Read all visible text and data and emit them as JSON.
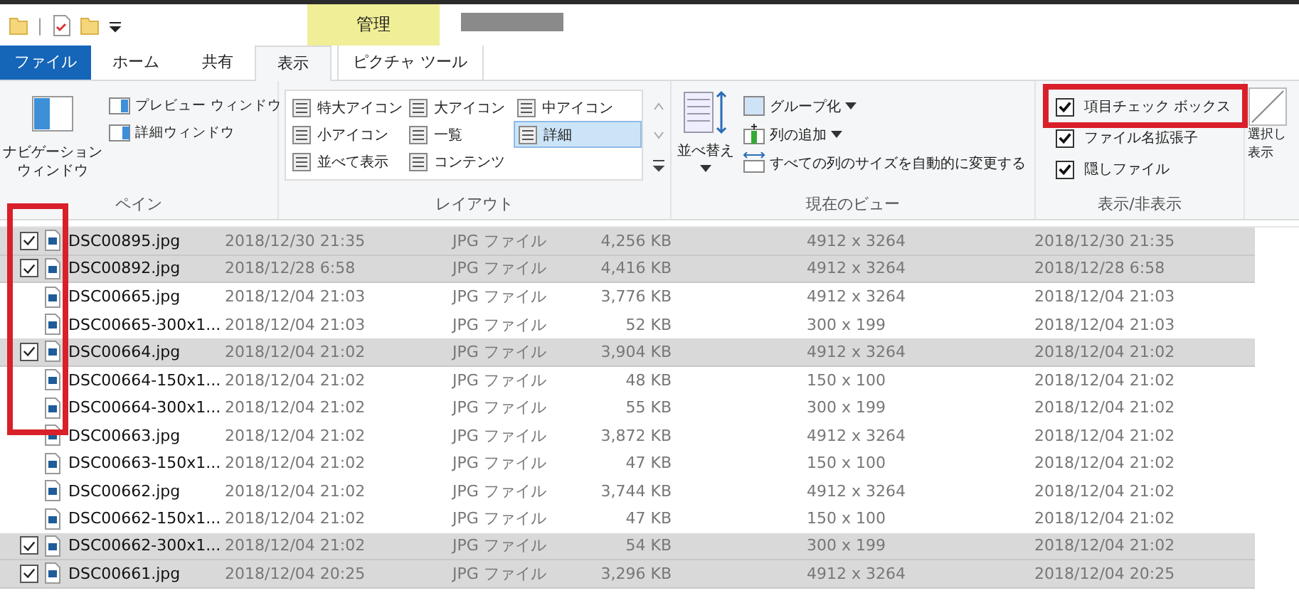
{
  "quick_access": {
    "separator": "|"
  },
  "context_tab": {
    "group": "管理",
    "label": "ピクチャ ツール"
  },
  "tabs": [
    {
      "label": "ファイル",
      "kind": "file",
      "selected": false
    },
    {
      "label": "ホーム",
      "kind": "plain",
      "selected": false
    },
    {
      "label": "共有",
      "kind": "plain",
      "selected": false
    },
    {
      "label": "表示",
      "kind": "plain",
      "selected": true
    }
  ],
  "ribbon": {
    "pane": {
      "title": "ペイン",
      "nav_button": [
        "ナビゲーション",
        "ウィンドウ"
      ],
      "items": [
        "プレビュー ウィンドウ",
        "詳細ウィンドウ"
      ]
    },
    "layout": {
      "title": "レイアウト",
      "items": [
        {
          "label": "特大アイコン",
          "selected": false
        },
        {
          "label": "大アイコン",
          "selected": false
        },
        {
          "label": "中アイコン",
          "selected": false
        },
        {
          "label": "小アイコン",
          "selected": false
        },
        {
          "label": "一覧",
          "selected": false
        },
        {
          "label": "詳細",
          "selected": true
        },
        {
          "label": "並べて表示",
          "selected": false
        },
        {
          "label": "コンテンツ",
          "selected": false
        }
      ]
    },
    "current_view": {
      "title": "現在のビュー",
      "sort": "並べ替え",
      "items": [
        {
          "label": "グループ化",
          "dropdown": true
        },
        {
          "label": "列の追加",
          "dropdown": true
        },
        {
          "label": "すべての列のサイズを自動的に変更する",
          "dropdown": false
        }
      ]
    },
    "show_hide": {
      "title": "表示/非表示",
      "options": [
        {
          "label": "項目チェック ボックス",
          "checked": true,
          "highlighted": true
        },
        {
          "label": "ファイル名拡張子",
          "checked": true,
          "highlighted": false
        },
        {
          "label": "隠しファイル",
          "checked": true,
          "highlighted": false
        }
      ]
    },
    "cut_button": [
      "選択し",
      "表示"
    ]
  },
  "files": [
    {
      "name": "DSC00895.jpg",
      "date": "2018/12/30 21:35",
      "type": "JPG ファイル",
      "size": "4,256 KB",
      "dimensions": "4912 x 3264",
      "date_taken": "2018/12/30 21:35",
      "checked": true
    },
    {
      "name": "DSC00892.jpg",
      "date": "2018/12/28 6:58",
      "type": "JPG ファイル",
      "size": "4,416 KB",
      "dimensions": "4912 x 3264",
      "date_taken": "2018/12/28 6:58",
      "checked": true
    },
    {
      "name": "DSC00665.jpg",
      "date": "2018/12/04 21:03",
      "type": "JPG ファイル",
      "size": "3,776 KB",
      "dimensions": "4912 x 3264",
      "date_taken": "2018/12/04 21:03",
      "checked": false
    },
    {
      "name": "DSC00665-300x1...",
      "date": "2018/12/04 21:03",
      "type": "JPG ファイル",
      "size": "52 KB",
      "dimensions": "300 x 199",
      "date_taken": "2018/12/04 21:03",
      "checked": false
    },
    {
      "name": "DSC00664.jpg",
      "date": "2018/12/04 21:02",
      "type": "JPG ファイル",
      "size": "3,904 KB",
      "dimensions": "4912 x 3264",
      "date_taken": "2018/12/04 21:02",
      "checked": true
    },
    {
      "name": "DSC00664-150x1...",
      "date": "2018/12/04 21:02",
      "type": "JPG ファイル",
      "size": "48 KB",
      "dimensions": "150 x 100",
      "date_taken": "2018/12/04 21:02",
      "checked": false
    },
    {
      "name": "DSC00664-300x1...",
      "date": "2018/12/04 21:02",
      "type": "JPG ファイル",
      "size": "55 KB",
      "dimensions": "300 x 199",
      "date_taken": "2018/12/04 21:02",
      "checked": false
    },
    {
      "name": "DSC00663.jpg",
      "date": "2018/12/04 21:02",
      "type": "JPG ファイル",
      "size": "3,872 KB",
      "dimensions": "4912 x 3264",
      "date_taken": "2018/12/04 21:02",
      "checked": false
    },
    {
      "name": "DSC00663-150x1...",
      "date": "2018/12/04 21:02",
      "type": "JPG ファイル",
      "size": "47 KB",
      "dimensions": "150 x 100",
      "date_taken": "2018/12/04 21:02",
      "checked": false
    },
    {
      "name": "DSC00662.jpg",
      "date": "2018/12/04 21:02",
      "type": "JPG ファイル",
      "size": "3,744 KB",
      "dimensions": "4912 x 3264",
      "date_taken": "2018/12/04 21:02",
      "checked": false
    },
    {
      "name": "DSC00662-150x1...",
      "date": "2018/12/04 21:02",
      "type": "JPG ファイル",
      "size": "47 KB",
      "dimensions": "150 x 100",
      "date_taken": "2018/12/04 21:02",
      "checked": false
    },
    {
      "name": "DSC00662-300x1...",
      "date": "2018/12/04 21:02",
      "type": "JPG ファイル",
      "size": "54 KB",
      "dimensions": "300 x 199",
      "date_taken": "2018/12/04 21:02",
      "checked": true
    },
    {
      "name": "DSC00661.jpg",
      "date": "2018/12/04 20:25",
      "type": "JPG ファイル",
      "size": "3,296 KB",
      "dimensions": "4912 x 3264",
      "date_taken": "2018/12/04 20:25",
      "checked": true
    }
  ],
  "file_list": {
    "checkbox_column_highlighted": true
  }
}
